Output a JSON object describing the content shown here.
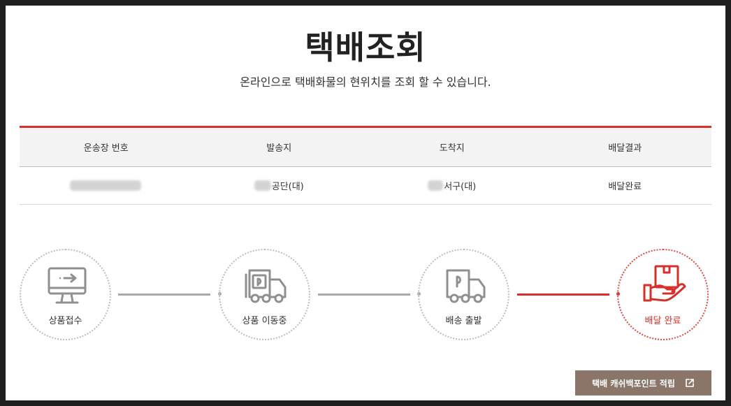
{
  "page": {
    "title": "택배조회",
    "subtitle": "온라인으로 택배화물의 현위치를 조회 할 수 있습니다."
  },
  "table": {
    "headers": [
      "운송장 번호",
      "발송지",
      "도착지",
      "배달결과"
    ],
    "row": {
      "origin": "공단(대)",
      "destination": "서구(대)",
      "result": "배달완료"
    }
  },
  "steps": [
    {
      "label": "상품접수",
      "icon": "monitor-arrow-icon",
      "active": false
    },
    {
      "label": "상품 이동중",
      "icon": "moving-truck-icon",
      "active": false
    },
    {
      "label": "배송 출발",
      "icon": "delivery-truck-icon",
      "active": false
    },
    {
      "label": "배달 완료",
      "icon": "hand-package-icon",
      "active": true
    }
  ],
  "cash_button": {
    "label": "택배 캐쉬백포인트 적립",
    "icon": "external-link-icon"
  },
  "colors": {
    "accent": "#d7302a",
    "inactive": "#a9a9a9",
    "button": "#8a7568"
  }
}
